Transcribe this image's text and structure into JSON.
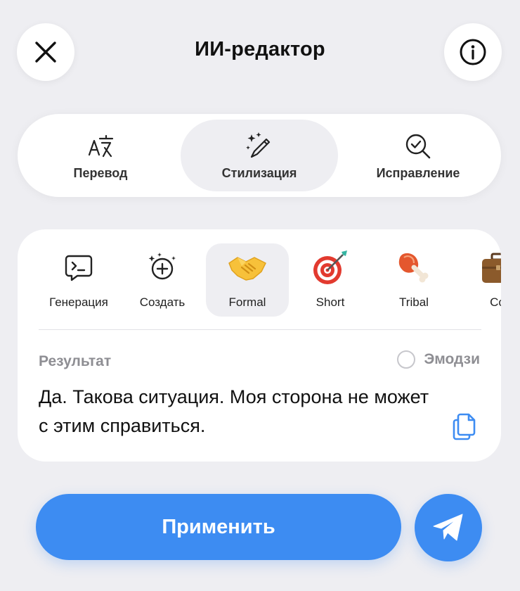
{
  "header": {
    "title": "ИИ-редактор",
    "close_icon": "close-icon",
    "info_icon": "info-icon"
  },
  "modes": [
    {
      "label": "Перевод",
      "icon": "translate-icon",
      "active": false
    },
    {
      "label": "Стилизация",
      "icon": "magic-pen-icon",
      "active": true
    },
    {
      "label": "Исправление",
      "icon": "check-search-icon",
      "active": false
    }
  ],
  "styles": [
    {
      "label": "Генерация",
      "icon": "terminal-icon",
      "active": false
    },
    {
      "label": "Создать",
      "icon": "add-sparkle-icon",
      "active": false
    },
    {
      "label": "Formal",
      "icon": "handshake-emoji",
      "active": true
    },
    {
      "label": "Short",
      "icon": "target-emoji",
      "active": false
    },
    {
      "label": "Tribal",
      "icon": "meat-emoji",
      "active": false
    },
    {
      "label": "Co",
      "icon": "briefcase-emoji",
      "active": false
    }
  ],
  "result": {
    "label": "Результат",
    "emoji_label": "Эмодзи",
    "emoji_checked": false,
    "text": "Да. Такова ситуация. Моя сторона не может с этим справиться."
  },
  "actions": {
    "apply_label": "Применить",
    "send_icon": "send-icon"
  },
  "colors": {
    "accent": "#3d8cf2",
    "background": "#eeeef2"
  }
}
